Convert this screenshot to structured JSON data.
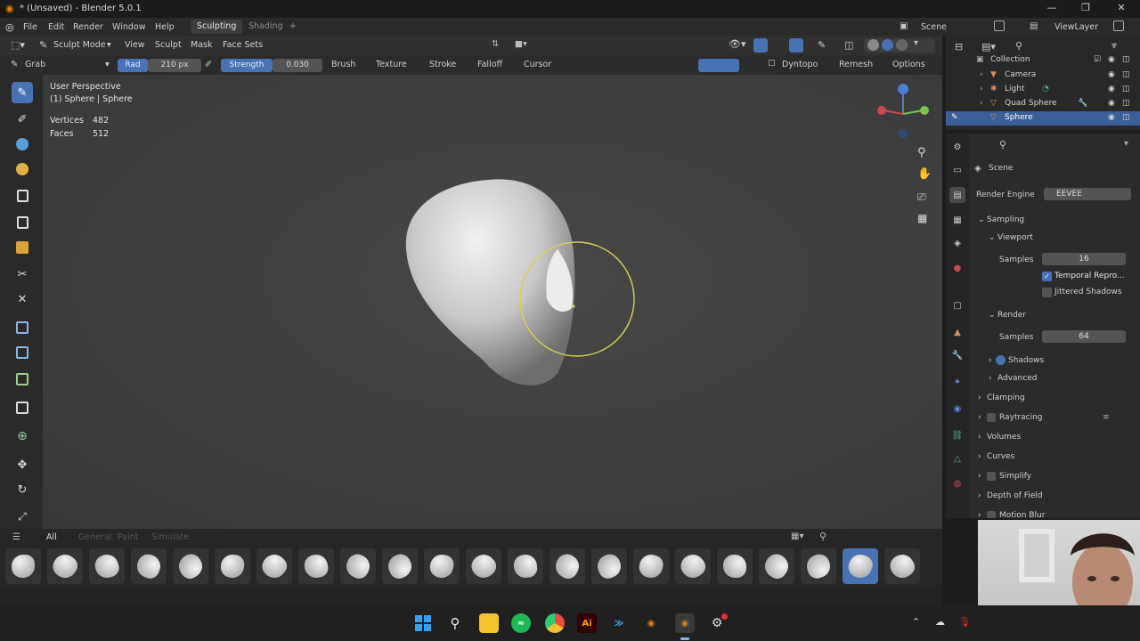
{
  "window": {
    "title": "* (Unsaved) - Blender 5.0.1",
    "controls": {
      "minimize": "—",
      "maximize": "❐",
      "close": "✕"
    }
  },
  "menubar": {
    "items": [
      "File",
      "Edit",
      "Render",
      "Window",
      "Help"
    ],
    "workspaces": [
      "Sculpting",
      "Shading"
    ],
    "add_tab": "+",
    "scene_label": "Scene",
    "view_layer_label": "ViewLayer"
  },
  "header": {
    "mode": "Sculpt Mode",
    "menus": [
      "View",
      "Sculpt",
      "Mask",
      "Face Sets"
    ]
  },
  "tool_settings": {
    "brush_name": "Grab",
    "radius_label": "Rad",
    "radius_value": "210 px",
    "strength_label": "Strength",
    "strength_value": "0.030",
    "menus": [
      "Brush",
      "Texture",
      "Stroke",
      "Falloff",
      "Cursor"
    ],
    "right_menus": [
      "Dyntopo",
      "Remesh",
      "Options"
    ]
  },
  "viewport": {
    "view_name": "User Perspective",
    "object_name": "(1) Sphere | Sphere",
    "stats": [
      {
        "label": "Vertices",
        "value": "482"
      },
      {
        "label": "Faces",
        "value": "512"
      }
    ]
  },
  "asset_shelf": {
    "tabs": [
      "All",
      "General",
      "Paint",
      "Simulate"
    ],
    "thumb_count": 22,
    "selected_index": 20
  },
  "outliner": {
    "items": [
      {
        "name": "Collection",
        "icon": "collection-icon"
      },
      {
        "name": "Camera",
        "icon": "camera-icon"
      },
      {
        "name": "Light",
        "icon": "light-icon"
      },
      {
        "name": "Quad Sphere",
        "icon": "mesh-icon"
      },
      {
        "name": "Sphere",
        "icon": "mesh-icon"
      }
    ]
  },
  "properties": {
    "scene_label": "Scene",
    "render_engine_label": "Render Engine",
    "render_engine_value": "EEVEE",
    "sampling_label": "Sampling",
    "viewport_label": "Viewport",
    "viewport_samples_label": "Samples",
    "viewport_samples_value": "16",
    "temporal_label": "Temporal Repro...",
    "jitter_label": "Jittered Shadows",
    "render_label": "Render",
    "render_samples_label": "Samples",
    "render_samples_value": "64",
    "shadows_label": "Shadows",
    "advanced_label": "Advanced",
    "sections": [
      "Clamping",
      "Raytracing",
      "Volumes",
      "Curves",
      "Simplify",
      "Depth of Field",
      "Motion Blur"
    ]
  },
  "colors": {
    "accent": "#4772b3",
    "brush_circle": "#d9d24a",
    "active_object": "#3a5f99"
  },
  "taskbar": {
    "icons": [
      "windows-start",
      "search",
      "file-explorer",
      "spotify",
      "chrome",
      "adobe-illustrator",
      "blender-launcher",
      "blender",
      "steam-like"
    ]
  }
}
